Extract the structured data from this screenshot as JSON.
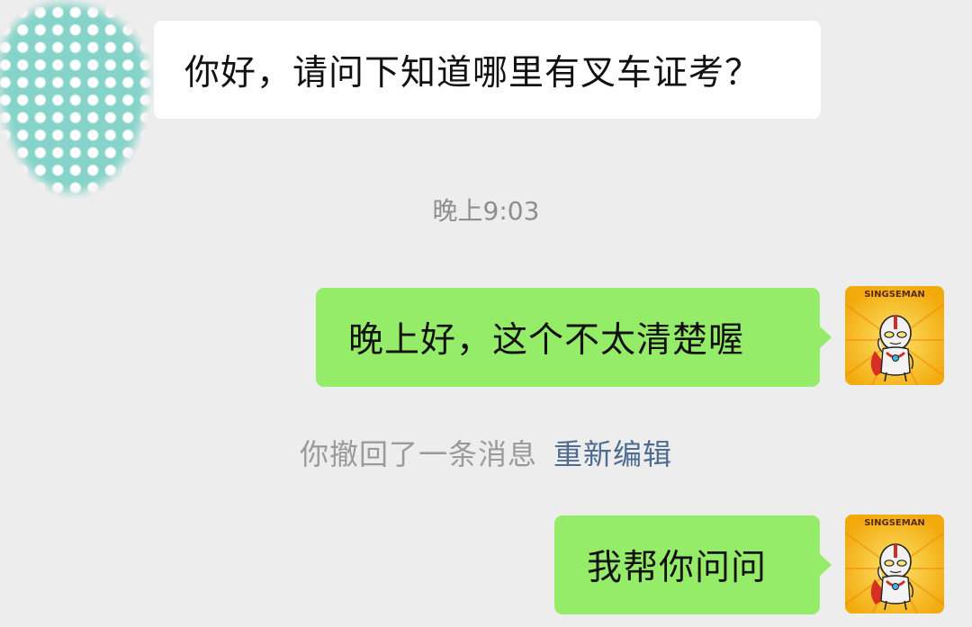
{
  "chat": {
    "messages": [
      {
        "side": "incoming",
        "text": "你好，请问下知道哪里有叉车证考？"
      },
      {
        "side": "outgoing",
        "text": "晚上好，这个不太清楚喔"
      },
      {
        "side": "outgoing",
        "text": "我帮你问问"
      }
    ],
    "timestamp": "晚上9:03",
    "system_notice": {
      "text": "你撤回了一条消息",
      "action_label": "重新编辑"
    },
    "my_avatar": {
      "caption": "SINGSEMAN",
      "icon": "ultraman-sticker-icon"
    },
    "other_avatar": {
      "icon": "polka-dot-avatar-icon"
    }
  },
  "colors": {
    "background": "#ededed",
    "incoming_bubble": "#ffffff",
    "outgoing_bubble": "#95ec69",
    "link": "#4e6b91",
    "avatar_teal": "#86d3c9",
    "avatar_yellow": "#f6c21a"
  }
}
